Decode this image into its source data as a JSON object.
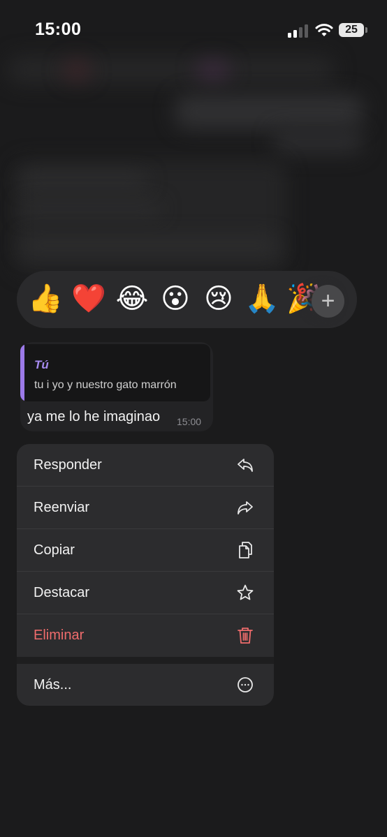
{
  "status_bar": {
    "time": "15:00",
    "battery": "25"
  },
  "reactions": {
    "emojis": [
      "👍",
      "❤️",
      "😂",
      "😮",
      "😢",
      "🙏",
      "🎉"
    ],
    "more_label": "+"
  },
  "message": {
    "quote_author": "Tú",
    "quote_text": "tu i yo y nuestro gato marrón",
    "text": "ya me lo he imaginao",
    "time": "15:00"
  },
  "menu": {
    "items": [
      {
        "label": "Responder",
        "icon": "reply-icon"
      },
      {
        "label": "Reenviar",
        "icon": "forward-icon"
      },
      {
        "label": "Copiar",
        "icon": "copy-icon"
      },
      {
        "label": "Destacar",
        "icon": "star-icon"
      },
      {
        "label": "Eliminar",
        "icon": "trash-icon"
      }
    ],
    "more": {
      "label": "Más...",
      "icon": "more-icon"
    }
  },
  "colors": {
    "accent": "#a78bf0",
    "danger": "#ef6c6c",
    "menu_bg": "#2c2c2e",
    "background": "#1b1b1c"
  }
}
